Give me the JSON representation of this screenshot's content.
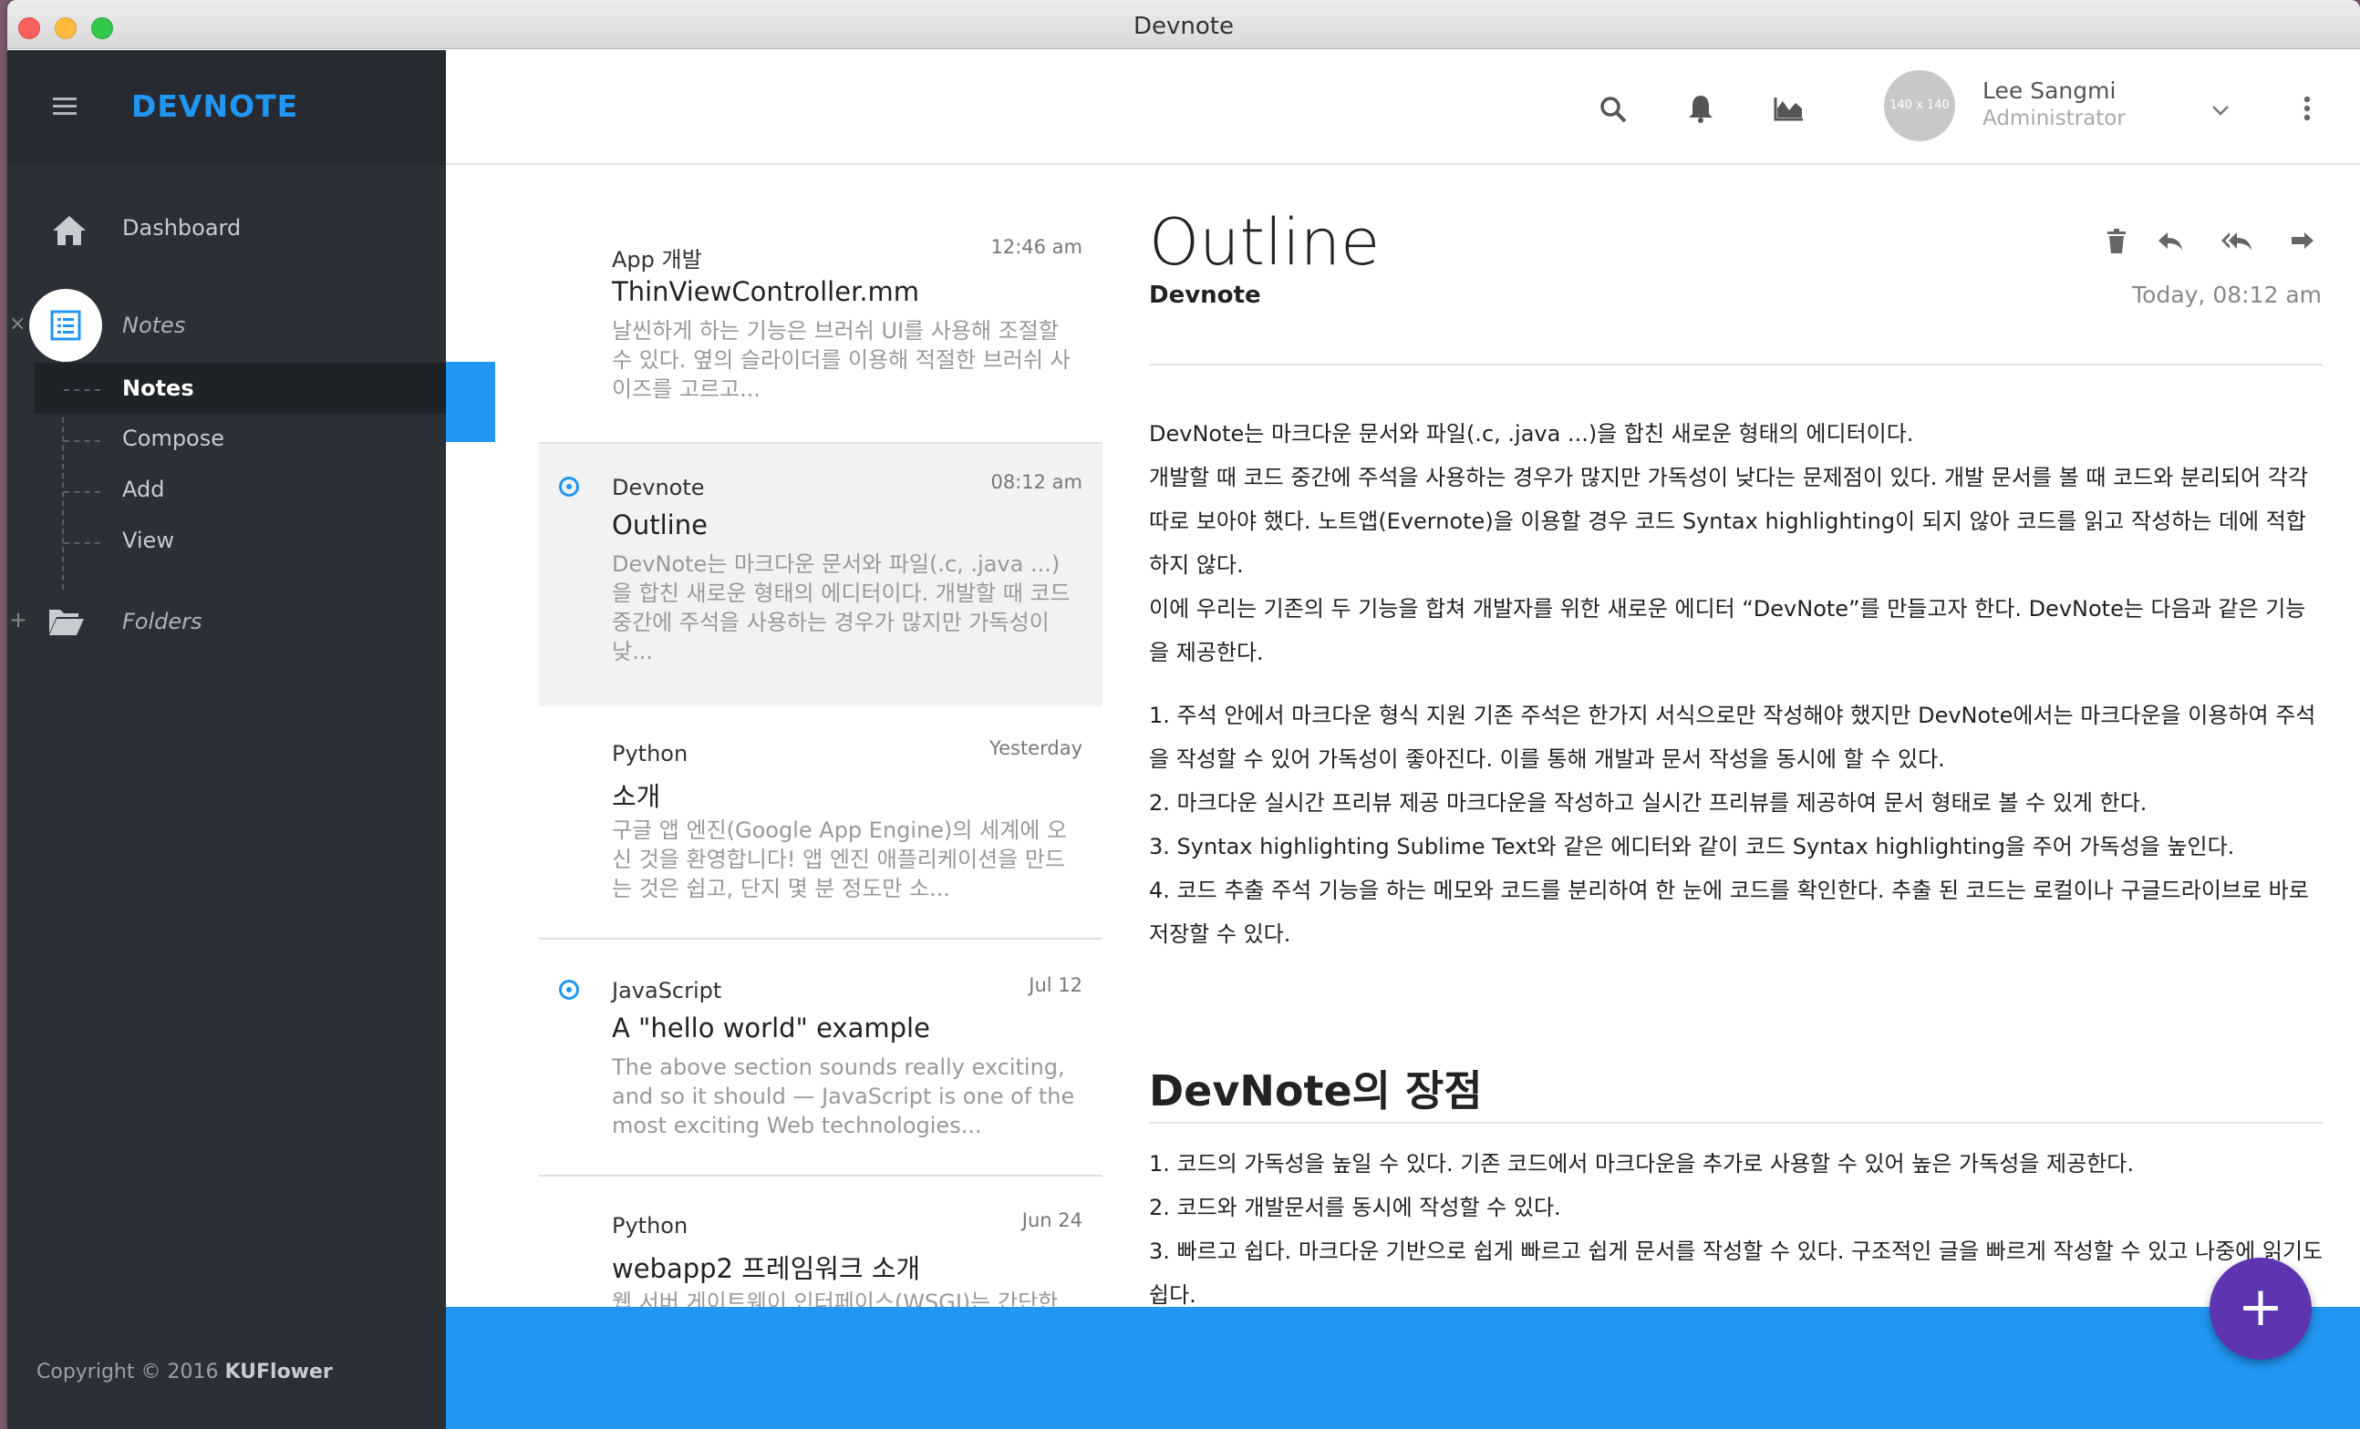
{
  "window": {
    "title": "Devnote"
  },
  "sidebar": {
    "brand": "DEVNOTE",
    "dashboard": "Dashboard",
    "notes_group": "Notes",
    "sub_items": [
      "Notes",
      "Compose",
      "Add",
      "View"
    ],
    "folders": "Folders",
    "collapse_mark": "×",
    "expand_mark": "+",
    "footer_prefix": "Copyright © 2016 ",
    "footer_brand": "KUFlower"
  },
  "header": {
    "avatar_text": "140 x 140",
    "user_name": "Lee Sangmi",
    "user_role": "Administrator"
  },
  "notes": [
    {
      "category": "App 개발",
      "time": "12:46 am",
      "title": "ThinViewController.mm",
      "summary": "날씬하게 하는 기능은 브러쉬 UI를 사용해 조절할 수 있다. 옆의 슬라이더를 이용해 적절한 브러쉬 사이즈를 고르고...",
      "marked": false
    },
    {
      "category": "Devnote",
      "time": "08:12 am",
      "title": "Outline",
      "summary": "DevNote는 마크다운 문서와 파일(.c, .java ...)을 합친 새로운 형태의 에디터이다. 개발할 때 코드 중간에 주석을 사용하는 경우가 많지만 가독성이 낮...",
      "marked": true
    },
    {
      "category": "Python",
      "time": "Yesterday",
      "title": "소개",
      "summary": "구글 앱 엔진(Google App Engine)의 세계에 오신 것을 환영합니다! 앱 엔진 애플리케이션을 만드는 것은 쉽고, 단지 몇 분 정도만 소...",
      "marked": false
    },
    {
      "category": "JavaScript",
      "time": "Jul 12",
      "title": "A \"hello world\" example",
      "summary": "The above section sounds really exciting, and so it should — JavaScript is one of the most exciting Web technologies...",
      "marked": true
    },
    {
      "category": "Python",
      "time": "Jun 24",
      "title": "webapp2 프레임워크 소개",
      "summary": "웹 서버 게이트웨이 인터페이스(WSGI)는 간단한",
      "marked": false
    }
  ],
  "detail": {
    "title": "Outline",
    "category": "Devnote",
    "date": "Today, 08:12 am",
    "paragraphs": [
      "DevNote는 마크다운 문서와 파일(.c, .java ...)을 합친 새로운 형태의 에디터이다.",
      "개발할 때 코드 중간에 주석을 사용하는 경우가 많지만 가독성이 낮다는 문제점이 있다. 개발 문서를 볼 때 코드와 분리되어 각각 따로 보아야 했다. 노트앱(Evernote)을 이용할 경우 코드 Syntax highlighting이 되지 않아 코드를 읽고 작성하는 데에 적합하지 않다.",
      "이에 우리는 기존의 두 기능을 합쳐 개발자를 위한 새로운 에디터 “DevNote”를 만들고자 한다. DevNote는 다음과 같은 기능을 제공한다."
    ],
    "features": [
      "1. 주석 안에서 마크다운 형식 지원 기존 주석은 한가지 서식으로만 작성해야 했지만 DevNote에서는 마크다운을 이용하여 주석을 작성할 수 있어 가독성이 좋아진다. 이를 통해 개발과 문서 작성을 동시에 할 수 있다.",
      "2. 마크다운 실시간 프리뷰 제공 마크다운을 작성하고 실시간 프리뷰를 제공하여 문서 형태로 볼 수 있게 한다.",
      "3. Syntax highlighting Sublime Text와 같은 에디터와 같이 코드 Syntax highlighting을 주어 가독성을 높인다.",
      "4. 코드 추출 주석 기능을 하는 메모와 코드를 분리하여 한 눈에 코드를 확인한다. 추출 된 코드는 로컬이나 구글드라이브로 바로 저장할 수 있다."
    ],
    "heading2": "DevNote의 장점",
    "advantages": [
      "1. 코드의 가독성을 높일 수 있다. 기존 코드에서 마크다운을 추가로 사용할 수 있어 높은 가독성을 제공한다.",
      "2. 코드와 개발문서를 동시에 작성할 수 있다.",
      "3. 빠르고 쉽다. 마크다운 기반으로 쉽게 빠르고 쉽게 문서를 작성할 수 있다. 구조적인 글을 빠르게 작성할 수 있고 나중에 읽기도 쉽다."
    ]
  },
  "fab": {
    "label": "+"
  },
  "colors": {
    "accent": "#2196f3",
    "sidebar": "#2b2f36",
    "fab": "#5e35b1"
  }
}
